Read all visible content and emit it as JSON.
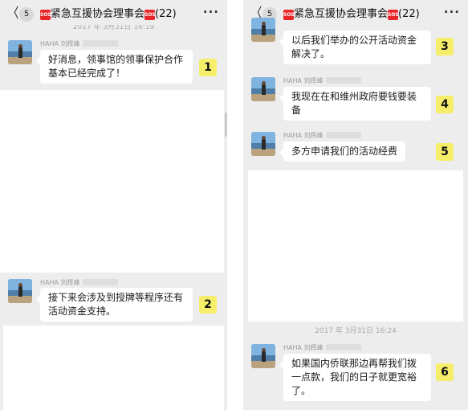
{
  "left": {
    "back_glyph": "〈",
    "unread_count": "5",
    "sos_badge": "SOS",
    "group_name": "紧急互援协会理事会",
    "member_count": "(22)",
    "more_glyph": "···",
    "top_time": "2017 年 3月31日 16:19",
    "messages": [
      {
        "sender": "HAHA 刘辉峰",
        "text": "好消息，领事馆的领事保护合作基本已经完成了！",
        "marker": "1"
      },
      {
        "sender": "HAHA 刘辉峰",
        "text": "接下来会涉及到授牌等程序还有活动资金支持。",
        "marker": "2"
      }
    ]
  },
  "right": {
    "back_glyph": "〈",
    "unread_count": "5",
    "sos_badge": "SOS",
    "group_name": "紧急互援协会理事会",
    "member_count": "(22)",
    "more_glyph": "···",
    "time_divider": "2017 年 3月31日 16:24",
    "messages": [
      {
        "sender": "",
        "text": "以后我们举办的公开活动资金解决了。",
        "marker": "3"
      },
      {
        "sender": "HAHA 刘辉峰",
        "text": "我现在在和维州政府要钱要装备",
        "marker": "4"
      },
      {
        "sender": "HAHA 刘辉峰",
        "text": "多方申请我们的活动经费",
        "marker": "5"
      },
      {
        "sender": "HAHA 刘辉峰",
        "text": "如果国内侨联那边再帮我们拨一点款，我们的日子就更宽裕了。",
        "marker": "6"
      }
    ]
  }
}
